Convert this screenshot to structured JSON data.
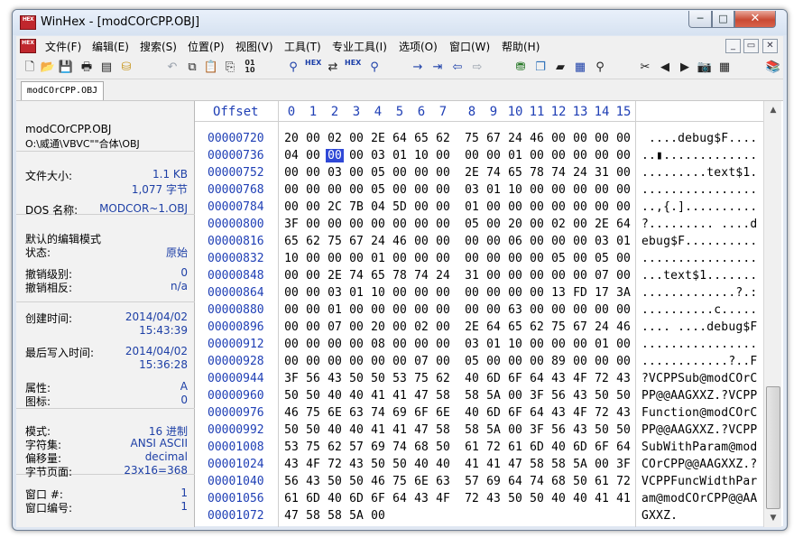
{
  "window": {
    "app_icon": "HEX",
    "title": "WinHex - [modCOrCPP.OBJ]",
    "min_label": "─",
    "max_label": "□",
    "close_label": "✕"
  },
  "menu": {
    "items": [
      "文件(F)",
      "编辑(E)",
      "搜索(S)",
      "位置(P)",
      "视图(V)",
      "工具(T)",
      "专业工具(I)",
      "选项(O)",
      "窗口(W)",
      "帮助(H)"
    ],
    "mdi_min": "_",
    "mdi_restore": "▭",
    "mdi_close": "✕"
  },
  "toolbar": {
    "icons": [
      "new-file-icon",
      "open-folder-icon",
      "save-icon",
      "print-icon",
      "properties-icon",
      "open-disk-icon",
      "undo-icon",
      "copy-icon",
      "paste-icon",
      "paste-special-icon",
      "hex-data-icon",
      "find-text-icon",
      "find-hex-icon",
      "replace-text-icon",
      "replace-hex-icon",
      "find-again-icon",
      "goto-offset-icon",
      "goto-sector-icon",
      "back-icon",
      "forward-icon",
      "open-drive-icon",
      "clone-icon",
      "ram-editor-icon",
      "calculator-icon",
      "magnifier-icon",
      "disk-tools-icon",
      "prev-icon",
      "next-icon",
      "camera-icon",
      "table-icon",
      "books-icon"
    ],
    "hex_label": "01\n10",
    "hex_small": "HEX"
  },
  "tab": {
    "label": "modCOrCPP.OBJ"
  },
  "info": {
    "file_name": "modCOrCPP.OBJ",
    "file_path": "O:\\威通\\VBVC\"\"合体\\OBJ",
    "file_size_label": "文件大小:",
    "file_size_kb": "1.1 KB",
    "file_size_bytes": "1,077 字节",
    "dos_name_label": "DOS 名称:",
    "dos_name": "MODCOR~1.OBJ",
    "edit_mode_label": "默认的编辑模式",
    "state_label": "状态:",
    "state_value": "原始",
    "undo_level_label": "撤销级别:",
    "undo_level_value": "0",
    "undo_reverse_label": "撤销相反:",
    "undo_reverse_value": "n/a",
    "created_label": "创建时间:",
    "created_date": "2014/04/02",
    "created_time": "15:43:39",
    "modified_label": "最后写入时间:",
    "modified_date": "2014/04/02",
    "modified_time": "15:36:28",
    "attr_label": "属性:",
    "attr_value": "A",
    "icon_label": "图标:",
    "icon_value": "0",
    "mode_label": "模式:",
    "mode_value": "16 进制",
    "charset_label": "字符集:",
    "charset_value": "ANSI ASCII",
    "offset_label": "偏移量:",
    "offset_value": "decimal",
    "bytes_page_label": "字节页面:",
    "bytes_page_value": "23x16=368",
    "window_no_label": "窗口 #:",
    "window_no_value": "1",
    "window_num_label": "窗口编号:",
    "window_num_value": "1"
  },
  "hex": {
    "offset_header": "Offset",
    "columns": [
      "0",
      "1",
      "2",
      "3",
      "4",
      "5",
      "6",
      "7",
      "8",
      "9",
      "10",
      "11",
      "12",
      "13",
      "14",
      "15"
    ],
    "selected": {
      "row": 1,
      "col": 2
    },
    "rows": [
      {
        "offset": "00000720",
        "bytes": [
          "20",
          "00",
          "02",
          "00",
          "2E",
          "64",
          "65",
          "62",
          "75",
          "67",
          "24",
          "46",
          "00",
          "00",
          "00",
          "00"
        ],
        "ascii": " ....debug$F...."
      },
      {
        "offset": "00000736",
        "bytes": [
          "04",
          "00",
          "00",
          "00",
          "03",
          "01",
          "10",
          "00",
          "00",
          "00",
          "01",
          "00",
          "00",
          "00",
          "00",
          "00"
        ],
        "ascii": "..▮............."
      },
      {
        "offset": "00000752",
        "bytes": [
          "00",
          "00",
          "03",
          "00",
          "05",
          "00",
          "00",
          "00",
          "2E",
          "74",
          "65",
          "78",
          "74",
          "24",
          "31",
          "00"
        ],
        "ascii": ".........text$1."
      },
      {
        "offset": "00000768",
        "bytes": [
          "00",
          "00",
          "00",
          "00",
          "05",
          "00",
          "00",
          "00",
          "03",
          "01",
          "10",
          "00",
          "00",
          "00",
          "00",
          "00"
        ],
        "ascii": "................"
      },
      {
        "offset": "00000784",
        "bytes": [
          "00",
          "00",
          "2C",
          "7B",
          "04",
          "5D",
          "00",
          "00",
          "01",
          "00",
          "00",
          "00",
          "00",
          "00",
          "00",
          "00"
        ],
        "ascii": "..,{.].........."
      },
      {
        "offset": "00000800",
        "bytes": [
          "3F",
          "00",
          "00",
          "00",
          "00",
          "00",
          "00",
          "00",
          "05",
          "00",
          "20",
          "00",
          "02",
          "00",
          "2E",
          "64"
        ],
        "ascii": "?......... ....d"
      },
      {
        "offset": "00000816",
        "bytes": [
          "65",
          "62",
          "75",
          "67",
          "24",
          "46",
          "00",
          "00",
          "00",
          "00",
          "06",
          "00",
          "00",
          "00",
          "03",
          "01"
        ],
        "ascii": "ebug$F.........."
      },
      {
        "offset": "00000832",
        "bytes": [
          "10",
          "00",
          "00",
          "00",
          "01",
          "00",
          "00",
          "00",
          "00",
          "00",
          "00",
          "00",
          "05",
          "00",
          "05",
          "00"
        ],
        "ascii": "................"
      },
      {
        "offset": "00000848",
        "bytes": [
          "00",
          "00",
          "2E",
          "74",
          "65",
          "78",
          "74",
          "24",
          "31",
          "00",
          "00",
          "00",
          "00",
          "00",
          "07",
          "00"
        ],
        "ascii": "...text$1......."
      },
      {
        "offset": "00000864",
        "bytes": [
          "00",
          "00",
          "03",
          "01",
          "10",
          "00",
          "00",
          "00",
          "00",
          "00",
          "00",
          "00",
          "13",
          "FD",
          "17",
          "3A"
        ],
        "ascii": ".............?.:"
      },
      {
        "offset": "00000880",
        "bytes": [
          "00",
          "00",
          "01",
          "00",
          "00",
          "00",
          "00",
          "00",
          "00",
          "00",
          "63",
          "00",
          "00",
          "00",
          "00",
          "00"
        ],
        "ascii": "..........c....."
      },
      {
        "offset": "00000896",
        "bytes": [
          "00",
          "00",
          "07",
          "00",
          "20",
          "00",
          "02",
          "00",
          "2E",
          "64",
          "65",
          "62",
          "75",
          "67",
          "24",
          "46"
        ],
        "ascii": ".... ....debug$F"
      },
      {
        "offset": "00000912",
        "bytes": [
          "00",
          "00",
          "00",
          "00",
          "08",
          "00",
          "00",
          "00",
          "03",
          "01",
          "10",
          "00",
          "00",
          "00",
          "01",
          "00"
        ],
        "ascii": "................"
      },
      {
        "offset": "00000928",
        "bytes": [
          "00",
          "00",
          "00",
          "00",
          "00",
          "00",
          "07",
          "00",
          "05",
          "00",
          "00",
          "00",
          "89",
          "00",
          "00",
          "00"
        ],
        "ascii": "............?..F"
      },
      {
        "offset": "00000944",
        "bytes": [
          "3F",
          "56",
          "43",
          "50",
          "50",
          "53",
          "75",
          "62",
          "40",
          "6D",
          "6F",
          "64",
          "43",
          "4F",
          "72",
          "43"
        ],
        "ascii": "?VCPPSub@modCOrC"
      },
      {
        "offset": "00000960",
        "bytes": [
          "50",
          "50",
          "40",
          "40",
          "41",
          "41",
          "47",
          "58",
          "58",
          "5A",
          "00",
          "3F",
          "56",
          "43",
          "50",
          "50"
        ],
        "ascii": "PP@@AAGXXZ.?VCPP"
      },
      {
        "offset": "00000976",
        "bytes": [
          "46",
          "75",
          "6E",
          "63",
          "74",
          "69",
          "6F",
          "6E",
          "40",
          "6D",
          "6F",
          "64",
          "43",
          "4F",
          "72",
          "43"
        ],
        "ascii": "Function@modCOrC"
      },
      {
        "offset": "00000992",
        "bytes": [
          "50",
          "50",
          "40",
          "40",
          "41",
          "41",
          "47",
          "58",
          "58",
          "5A",
          "00",
          "3F",
          "56",
          "43",
          "50",
          "50"
        ],
        "ascii": "PP@@AAGXXZ.?VCPP"
      },
      {
        "offset": "00001008",
        "bytes": [
          "53",
          "75",
          "62",
          "57",
          "69",
          "74",
          "68",
          "50",
          "61",
          "72",
          "61",
          "6D",
          "40",
          "6D",
          "6F",
          "64"
        ],
        "ascii": "SubWithParam@mod"
      },
      {
        "offset": "00001024",
        "bytes": [
          "43",
          "4F",
          "72",
          "43",
          "50",
          "50",
          "40",
          "40",
          "41",
          "41",
          "47",
          "58",
          "58",
          "5A",
          "00",
          "3F"
        ],
        "ascii": "COrCPP@@AAGXXZ.?"
      },
      {
        "offset": "00001040",
        "bytes": [
          "56",
          "43",
          "50",
          "50",
          "46",
          "75",
          "6E",
          "63",
          "57",
          "69",
          "64",
          "74",
          "68",
          "50",
          "61",
          "72"
        ],
        "ascii": "VCPPFuncWidthPar"
      },
      {
        "offset": "00001056",
        "bytes": [
          "61",
          "6D",
          "40",
          "6D",
          "6F",
          "64",
          "43",
          "4F",
          "72",
          "43",
          "50",
          "50",
          "40",
          "40",
          "41",
          "41"
        ],
        "ascii": "am@modCOrCPP@@AA"
      },
      {
        "offset": "00001072",
        "bytes": [
          "47",
          "58",
          "58",
          "5A",
          "00"
        ],
        "ascii": "GXXZ."
      }
    ]
  },
  "scroll": {
    "up": "▲",
    "down": "▼"
  }
}
